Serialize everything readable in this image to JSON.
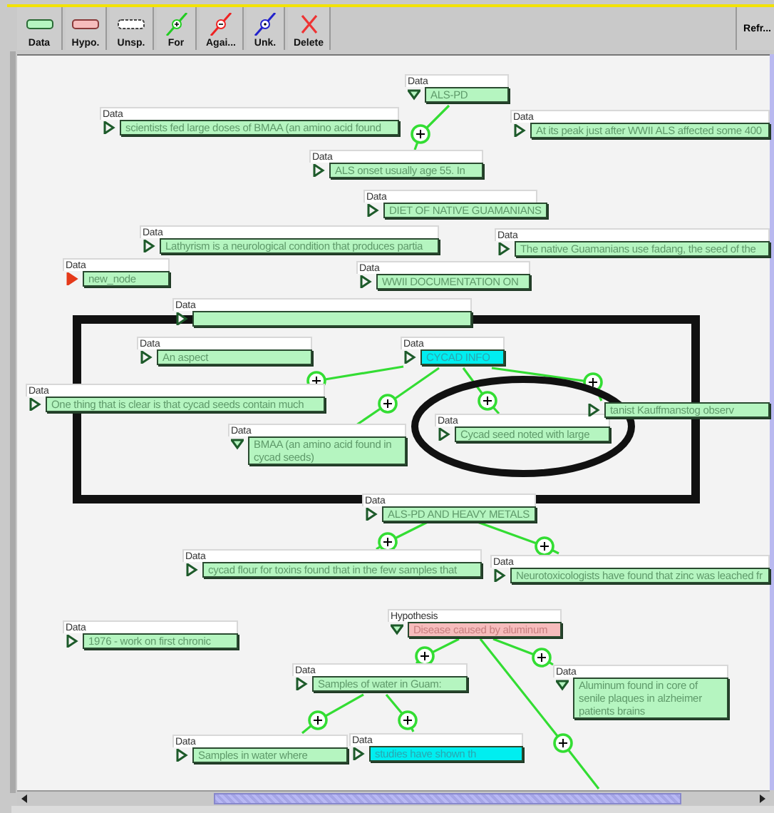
{
  "toolbar": {
    "buttons": [
      {
        "label": "Data",
        "kind": "data"
      },
      {
        "label": "Hypo.",
        "kind": "hypothesis"
      },
      {
        "label": "Unsp.",
        "kind": "unspecified"
      },
      {
        "label": "For",
        "kind": "for"
      },
      {
        "label": "Agai...",
        "kind": "against"
      },
      {
        "label": "Unk.",
        "kind": "unknown"
      },
      {
        "label": "Delete",
        "kind": "delete"
      }
    ],
    "refresh_label": "Refr..."
  },
  "nodes": [
    {
      "header": "Data",
      "text": "ALS-PD",
      "kind": "data",
      "selected": false,
      "expanded": true,
      "flagged": false
    },
    {
      "header": "Data",
      "text": "scientists fed large doses of BMAA (an amino acid found",
      "kind": "data",
      "selected": false,
      "expanded": false,
      "flagged": false
    },
    {
      "header": "Data",
      "text": "At its peak just after WWII ALS affected some 400",
      "kind": "data",
      "selected": false,
      "expanded": false,
      "flagged": false
    },
    {
      "header": "Data",
      "text": "ALS onset usually age 55.  In",
      "kind": "data",
      "selected": false,
      "expanded": false,
      "flagged": false
    },
    {
      "header": "Data",
      "text": "DIET OF NATIVE GUAMANIANS",
      "kind": "data",
      "selected": false,
      "expanded": false,
      "flagged": false
    },
    {
      "header": "Data",
      "text": "Lathyrism is a neurological condition that produces partia",
      "kind": "data",
      "selected": false,
      "expanded": false,
      "flagged": false
    },
    {
      "header": "Data",
      "text": "The native Guamanians use fadang, the seed of the",
      "kind": "data",
      "selected": false,
      "expanded": false,
      "flagged": false
    },
    {
      "header": "Data",
      "text": "new_node",
      "kind": "data",
      "selected": false,
      "expanded": false,
      "flagged": true
    },
    {
      "header": "Data",
      "text": "WWII DOCUMENTATION ON",
      "kind": "data",
      "selected": false,
      "expanded": false,
      "flagged": false
    },
    {
      "header": "Data",
      "kind": "data",
      "selected": false,
      "expanded": false,
      "flagged": false
    },
    {
      "header": "Data",
      "text": "An aspect",
      "kind": "data",
      "selected": false,
      "expanded": false,
      "flagged": false
    },
    {
      "header": "Data",
      "text": "CYCAD INFO",
      "kind": "data",
      "selected": true,
      "expanded": false,
      "flagged": false
    },
    {
      "header": "Data",
      "text": "One thing that is clear is that cycad seeds contain much",
      "kind": "data",
      "selected": false,
      "expanded": false,
      "flagged": false
    },
    {
      "header": "Data",
      "text": "BMAA (an amino acid found in cycad seeds)",
      "kind": "data",
      "selected": false,
      "expanded": true,
      "flagged": false
    },
    {
      "header": "Data",
      "text": "Cycad seed noted with large",
      "kind": "data",
      "selected": false,
      "expanded": false,
      "flagged": false
    },
    {
      "text": "tanist Kauffmanstog observ",
      "kind": "data",
      "selected": false,
      "expanded": false,
      "flagged": false
    },
    {
      "header": "Data",
      "text": "ALS-PD AND HEAVY METALS",
      "kind": "data",
      "selected": false,
      "expanded": false,
      "flagged": false
    },
    {
      "header": "Data",
      "text": "cycad flour for toxins found that in the few samples that",
      "kind": "data",
      "selected": false,
      "expanded": false,
      "flagged": false
    },
    {
      "header": "Data",
      "text": "Neurotoxicologists have found that zinc was leached fr",
      "kind": "data",
      "selected": false,
      "expanded": false,
      "flagged": false
    },
    {
      "header": "Data",
      "text": "1976 - work on first chronic",
      "kind": "data",
      "selected": false,
      "expanded": false,
      "flagged": false
    },
    {
      "header": "Hypothesis",
      "text": "Disease caused by aluminum",
      "kind": "hypothesis",
      "selected": false,
      "expanded": true,
      "flagged": false
    },
    {
      "header": "Data",
      "text": "Samples of water in Guam:",
      "kind": "data",
      "selected": false,
      "expanded": false,
      "flagged": false
    },
    {
      "header": "Data",
      "text": "Aluminum found in core of senile plaques in alzheimer patients brains",
      "kind": "data",
      "selected": false,
      "expanded": true,
      "flagged": false
    },
    {
      "header": "Data",
      "text": "Samples in water where",
      "kind": "data",
      "selected": false,
      "expanded": false,
      "flagged": false
    },
    {
      "header": "Data",
      "text": "studies have shown th",
      "kind": "data",
      "selected": true,
      "expanded": false,
      "flagged": false
    }
  ]
}
